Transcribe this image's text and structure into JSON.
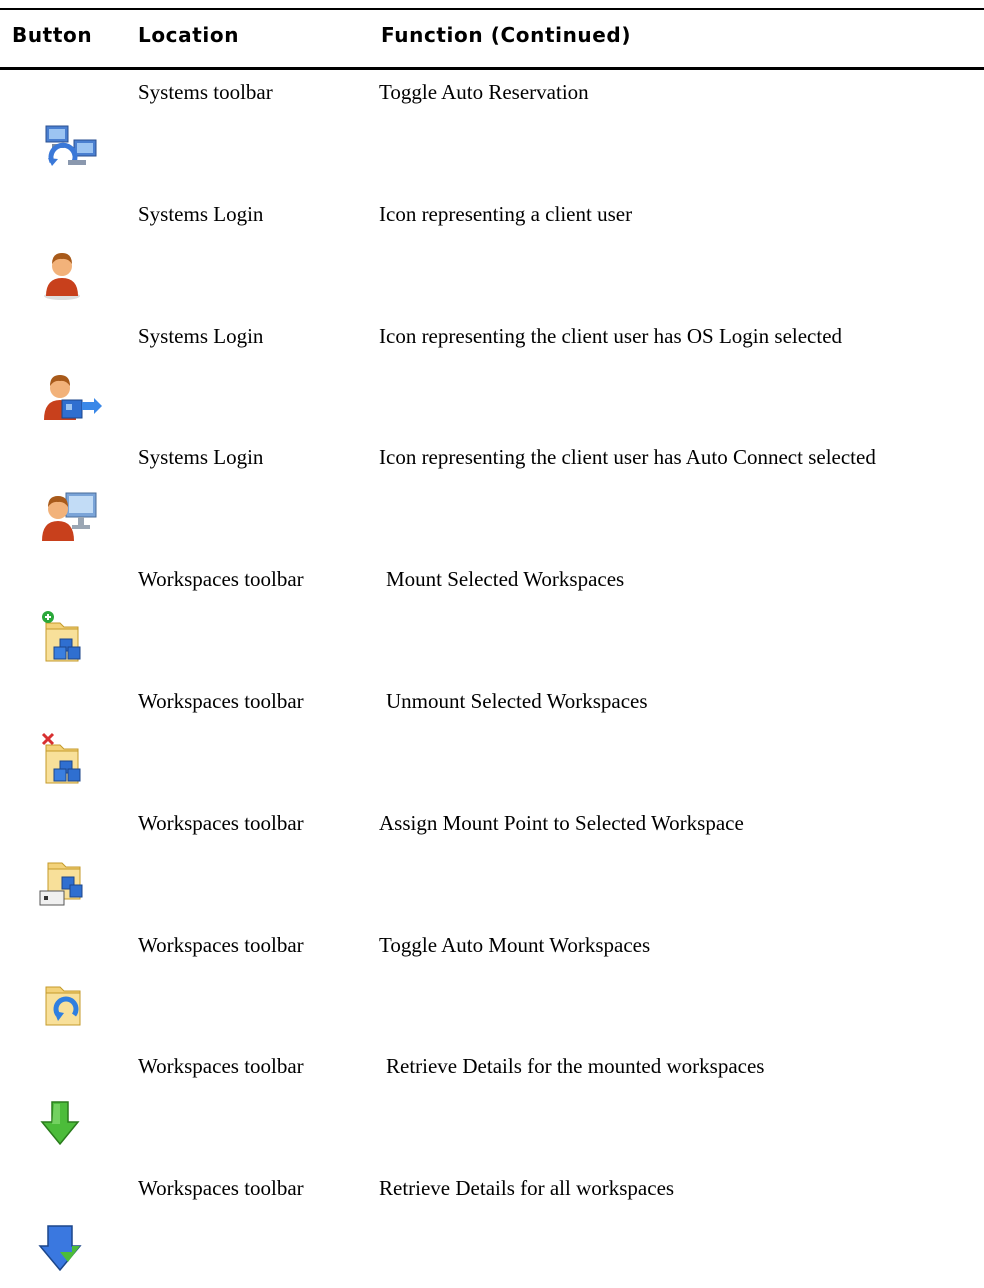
{
  "header": {
    "button": "Button",
    "location": "Location",
    "function": "Function (Continued)"
  },
  "rows": [
    {
      "icon": "network-reservation-icon",
      "location": "Systems toolbar",
      "function": "Toggle Auto Reservation"
    },
    {
      "icon": "client-user-icon",
      "location": "Systems Login",
      "function": "Icon representing a client user"
    },
    {
      "icon": "user-os-login-icon",
      "location": "Systems Login",
      "function": "Icon representing the client user has OS Login selected"
    },
    {
      "icon": "user-auto-connect-icon",
      "location": "Systems Login",
      "function": "Icon representing the client user has Auto Connect selected"
    },
    {
      "icon": "mount-workspace-icon",
      "location": "Workspaces toolbar",
      "function": "Mount Selected Workspaces"
    },
    {
      "icon": "unmount-workspace-icon",
      "location": "Workspaces toolbar",
      "function": "Unmount Selected Workspaces"
    },
    {
      "icon": "assign-mount-point-icon",
      "location": "Workspaces toolbar",
      "function": "Assign Mount Point to Selected Workspace"
    },
    {
      "icon": "auto-mount-icon",
      "location": "Workspaces toolbar",
      "function": "Toggle Auto Mount Workspaces"
    },
    {
      "icon": "green-down-arrow-icon",
      "location": "Workspaces toolbar",
      "function": "Retrieve Details for the mounted workspaces"
    },
    {
      "icon": "blue-down-arrow-icon",
      "location": "Workspaces toolbar",
      "function": "Retrieve Details for all workspaces"
    }
  ]
}
